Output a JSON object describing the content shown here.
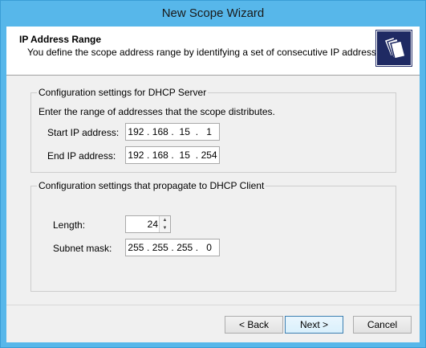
{
  "window": {
    "title": "New Scope Wizard"
  },
  "header": {
    "title": "IP Address Range",
    "subtitle": "You define the scope address range by identifying a set of consecutive IP addresses.",
    "icon": "folders-icon"
  },
  "server_group": {
    "legend": "Configuration settings for DHCP Server",
    "instruction": "Enter the range of addresses that the scope distributes.",
    "start": {
      "label": "Start IP address:",
      "octets": [
        "192",
        "168",
        "15",
        "1"
      ]
    },
    "end": {
      "label": "End IP address:",
      "octets": [
        "192",
        "168",
        "15",
        "254"
      ]
    }
  },
  "client_group": {
    "legend": "Configuration settings that propagate to DHCP Client",
    "length": {
      "label": "Length:",
      "value": "24"
    },
    "mask": {
      "label": "Subnet mask:",
      "octets": [
        "255",
        "255",
        "255",
        "0"
      ]
    }
  },
  "buttons": {
    "back": "< Back",
    "next": "Next >",
    "cancel": "Cancel"
  }
}
